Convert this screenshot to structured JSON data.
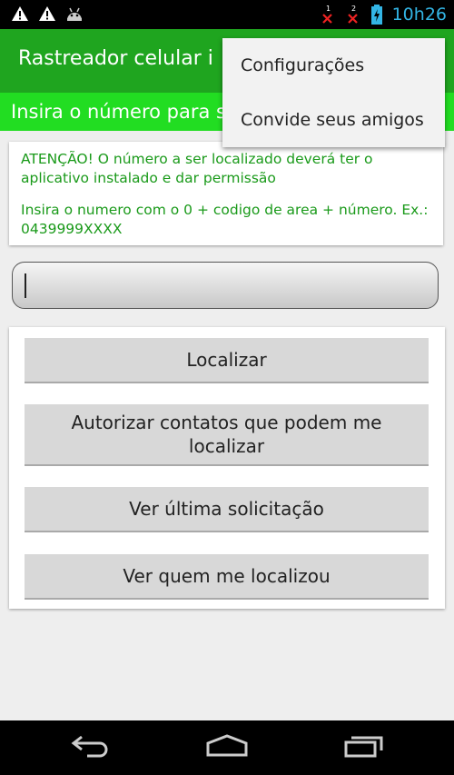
{
  "status_bar": {
    "time": "10h26",
    "left_icons": [
      "warning-icon",
      "warning-icon",
      "android-icon"
    ],
    "right_icons": [
      "sim-1-no-signal-icon",
      "sim-2-no-signal-icon",
      "battery-charging-icon"
    ],
    "sim_labels": [
      "1",
      "2"
    ],
    "time_color": "#33b5e5"
  },
  "action_bar": {
    "title": "Rastreador celular i",
    "color": "#1fa51f"
  },
  "subtitle_bar": {
    "text": "Insira o número para se",
    "color": "#22dd22"
  },
  "info": {
    "warning": "ATENÇÃO! O número a ser localizado deverá ter o aplicativo instalado e dar permissão",
    "instructions": "Insira o numero com o 0 + codigo de area + número. Ex.: 0439999XXXX"
  },
  "phone_input": {
    "value": ""
  },
  "buttons": {
    "locate": "Localizar",
    "authorize": "Autorizar contatos que podem me localizar",
    "last_request": "Ver última solicitação",
    "who_located": "Ver quem me localizou"
  },
  "menu": {
    "items": [
      "Configurações",
      "Convide seus amigos"
    ]
  },
  "nav_bar": {
    "icons": [
      "back-icon",
      "home-icon",
      "recent-apps-icon"
    ]
  }
}
